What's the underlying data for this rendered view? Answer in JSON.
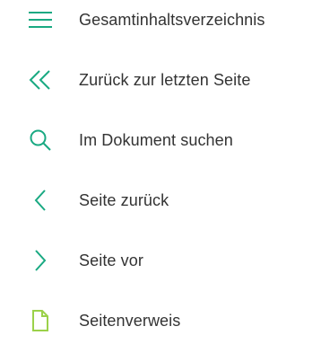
{
  "colors": {
    "icon_green": "#19a982",
    "icon_lime": "#9bd14a",
    "text": "#333333",
    "background": "#ffffff"
  },
  "menu": {
    "items": [
      {
        "label": "Gesamtinhaltsverzeichnis",
        "icon": "hamburger-menu-icon"
      },
      {
        "label": "Zurück zur letzten Seite",
        "icon": "double-chevron-left-icon"
      },
      {
        "label": "Im Dokument suchen",
        "icon": "search-icon"
      },
      {
        "label": "Seite zurück",
        "icon": "chevron-left-icon"
      },
      {
        "label": "Seite vor",
        "icon": "chevron-right-icon"
      },
      {
        "label": "Seitenverweis",
        "icon": "document-icon"
      }
    ]
  }
}
